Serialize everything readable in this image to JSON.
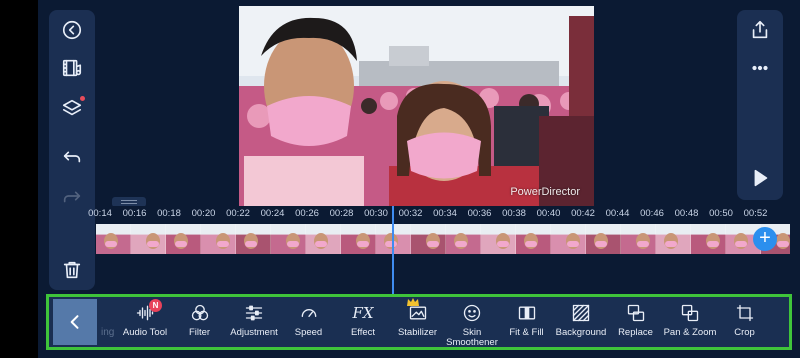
{
  "watermark": "PowerDirector",
  "colors": {
    "accent": "#2b8fee",
    "highlight": "#3fc43a",
    "badge": "#e8425a"
  },
  "left_toolbar": [
    "back-circle-icon",
    "media-library-icon",
    "layers-icon",
    "undo-icon",
    "redo-icon",
    "delete-icon"
  ],
  "right_toolbar": [
    "export-icon",
    "more-icon",
    "play-icon"
  ],
  "timeline": {
    "ticks": [
      "00:14",
      "00:16",
      "00:18",
      "00:20",
      "00:22",
      "00:24",
      "00:26",
      "00:28",
      "00:30",
      "00:32",
      "00:34",
      "00:36",
      "00:38",
      "00:40",
      "00:42",
      "00:44",
      "00:46",
      "00:48",
      "00:50",
      "00:52"
    ]
  },
  "bottom_toolbar": {
    "ghost_label": "ing",
    "tools": [
      {
        "label": "Audio Tool",
        "icon": "audio-wave-icon",
        "badge": "N"
      },
      {
        "label": "Filter",
        "icon": "filter-icon"
      },
      {
        "label": "Adjustment",
        "icon": "sliders-icon"
      },
      {
        "label": "Speed",
        "icon": "speedometer-icon"
      },
      {
        "label": "Effect",
        "icon": "fx-icon",
        "glyph": "FX"
      },
      {
        "label": "Stabilizer",
        "icon": "stabilizer-icon",
        "premium": true
      },
      {
        "label": "Skin\nSmoothener",
        "icon": "face-icon"
      },
      {
        "label": "Fit & Fill",
        "icon": "fit-fill-icon"
      },
      {
        "label": "Background",
        "icon": "background-icon"
      },
      {
        "label": "Replace",
        "icon": "replace-icon"
      },
      {
        "label": "Pan & Zoom",
        "icon": "pan-zoom-icon"
      },
      {
        "label": "Crop",
        "icon": "crop-icon"
      }
    ]
  }
}
